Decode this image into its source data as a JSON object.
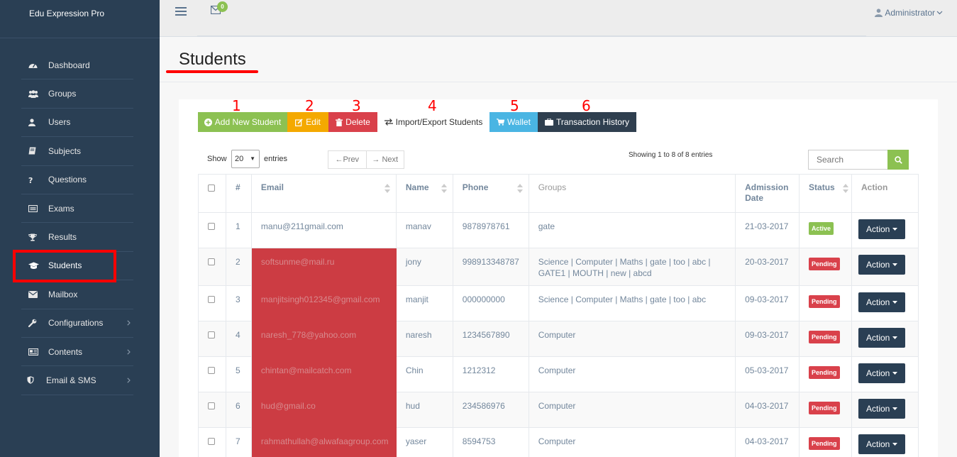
{
  "brand": "Edu Expression Pro",
  "nav": [
    {
      "label": "Dashboard",
      "icon": "dashboard-icon",
      "chevron": false,
      "active": false
    },
    {
      "label": "Groups",
      "icon": "groups-icon",
      "chevron": false,
      "active": false
    },
    {
      "label": "Users",
      "icon": "user-icon",
      "chevron": false,
      "active": false
    },
    {
      "label": "Subjects",
      "icon": "book-icon",
      "chevron": false,
      "active": false
    },
    {
      "label": "Questions",
      "icon": "question-icon",
      "chevron": false,
      "active": false
    },
    {
      "label": "Exams",
      "icon": "exams-icon",
      "chevron": false,
      "active": false
    },
    {
      "label": "Results",
      "icon": "trophy-icon",
      "chevron": false,
      "active": false
    },
    {
      "label": "Students",
      "icon": "graduation-cap-icon",
      "chevron": false,
      "active": true
    },
    {
      "label": "Mailbox",
      "icon": "envelope-icon",
      "chevron": false,
      "active": false
    },
    {
      "label": "Configurations",
      "icon": "wrench-icon",
      "chevron": true,
      "active": false
    },
    {
      "label": "Contents",
      "icon": "contents-icon",
      "chevron": true,
      "active": false
    },
    {
      "label": "Email & SMS",
      "icon": "shield-icon",
      "chevron": true,
      "active": false
    }
  ],
  "topbar": {
    "mail_count": "0",
    "user": "Administrator"
  },
  "page": {
    "title": "Students"
  },
  "toolbar": {
    "add": "Add New Student",
    "edit": "Edit",
    "delete": "Delete",
    "import": "Import/Export Students",
    "wallet": "Wallet",
    "history": "Transaction History"
  },
  "annotations": [
    "1",
    "2",
    "3",
    "4",
    "5",
    "6"
  ],
  "controls": {
    "show": "Show",
    "page_size": "20",
    "entries": "entries",
    "prev": "←Prev",
    "next": "→ Next",
    "info": "Showing 1 to 8 of 8 entries",
    "search_placeholder": "Search"
  },
  "table": {
    "columns": [
      "#",
      "Email",
      "Name",
      "Phone",
      "Groups",
      "Admission Date",
      "Status",
      "Action"
    ],
    "action_label": "Action",
    "rows": [
      {
        "num": "1",
        "email": "manu@211gmail.com",
        "name": "manav",
        "phone": "9878978761",
        "groups": "gate",
        "date": "21-03-2017",
        "status": "Active",
        "highlight": false
      },
      {
        "num": "2",
        "email": "softsunme@mail.ru",
        "name": "jony",
        "phone": "998913348787",
        "groups": "Science | Computer | Maths | gate | too | abc | GATE1 | MOUTH | new | abcd",
        "date": "20-03-2017",
        "status": "Pending",
        "highlight": true
      },
      {
        "num": "3",
        "email": "manjitsingh012345@gmail.com",
        "name": "manjit",
        "phone": "000000000",
        "groups": "Science | Computer | Maths | gate | too | abc",
        "date": "09-03-2017",
        "status": "Pending",
        "highlight": true
      },
      {
        "num": "4",
        "email": "naresh_778@yahoo.com",
        "name": "naresh",
        "phone": "1234567890",
        "groups": "Computer",
        "date": "09-03-2017",
        "status": "Pending",
        "highlight": true
      },
      {
        "num": "5",
        "email": "chintan@mailcatch.com",
        "name": "Chin",
        "phone": "1212312",
        "groups": "Computer",
        "date": "05-03-2017",
        "status": "Pending",
        "highlight": true
      },
      {
        "num": "6",
        "email": "hud@gmail.co",
        "name": "hud",
        "phone": "234586976",
        "groups": "Computer",
        "date": "04-03-2017",
        "status": "Pending",
        "highlight": true
      },
      {
        "num": "7",
        "email": "rahmathullah@alwafaagroup.com",
        "name": "yaser",
        "phone": "8594753",
        "groups": "Computer",
        "date": "04-03-2017",
        "status": "Pending",
        "highlight": true
      }
    ]
  },
  "colors": {
    "sidebar": "#2a3f54",
    "green": "#8cc152",
    "orange": "#f4a900",
    "red": "#d9414b",
    "blue": "#4ab5e3",
    "dark": "#2f3f4f",
    "highlight_red": "#cc3c43",
    "annotation_red": "#ff0000"
  }
}
